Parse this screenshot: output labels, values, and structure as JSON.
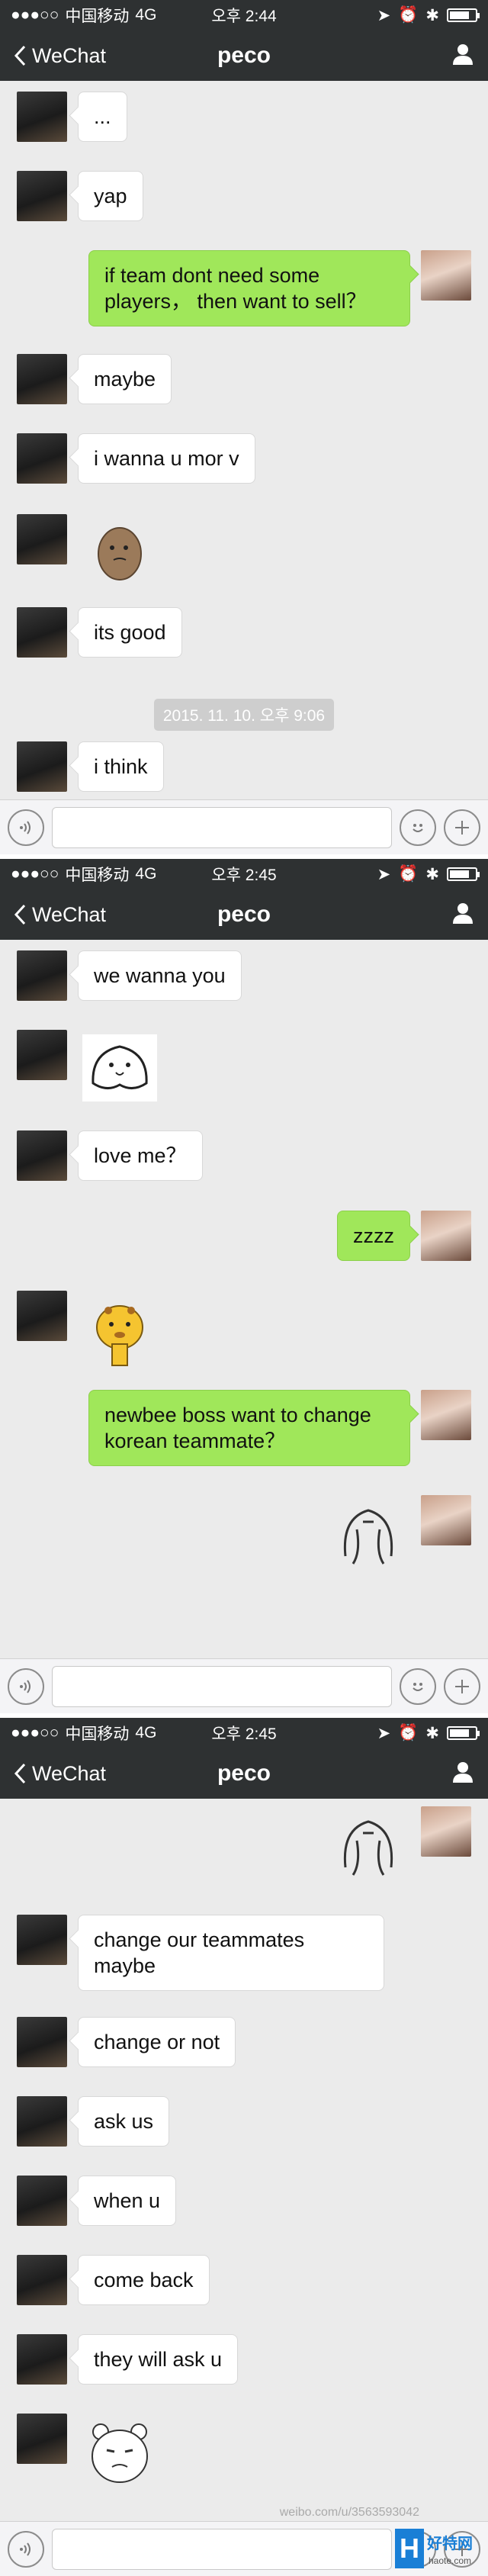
{
  "status": {
    "carrier": "中国移动",
    "network": "4G",
    "battery_level": 0.7
  },
  "nav": {
    "back_label": "WeChat",
    "title": "peco"
  },
  "panels": [
    {
      "time": "오후 2:44",
      "timestamp": "2015. 11. 10. 오후 9:06",
      "messages": [
        {
          "text": "..."
        },
        {
          "text": "yap"
        },
        {
          "text": "if team dont need some players， then want to sell？"
        },
        {
          "text": "maybe"
        },
        {
          "text": "i wanna u mor v"
        },
        {
          "sticker": "potato-sticker"
        },
        {
          "text": "its good"
        },
        {
          "text": "i think"
        }
      ]
    },
    {
      "time": "오후 2:45",
      "messages": [
        {
          "text": "we wanna you"
        },
        {
          "sticker": "blob-sticker"
        },
        {
          "text": "love me？"
        },
        {
          "text": "zzzz"
        },
        {
          "sticker": "giraffe-sticker"
        },
        {
          "text": "newbee boss want to change korean teammate？"
        },
        {
          "sticker": "sad-sketch-sticker"
        }
      ]
    },
    {
      "time": "오후 2:45",
      "messages": [
        {
          "sticker": "sad-sketch-sticker"
        },
        {
          "text": "change our teammates maybe"
        },
        {
          "text": "change or not"
        },
        {
          "text": "ask us"
        },
        {
          "text": "when u"
        },
        {
          "text": "come back"
        },
        {
          "text": "they will ask u"
        },
        {
          "sticker": "bear-sticker"
        }
      ]
    }
  ],
  "watermark": "weibo.com/u/3563593042",
  "logo": {
    "text": "好特网",
    "domain": "haote.com",
    "letter": "H"
  },
  "colors": {
    "header": "#2e3132",
    "chat_bg": "#ebebeb",
    "green_bubble": "#a0e75a",
    "white_bubble": "#ffffff"
  }
}
